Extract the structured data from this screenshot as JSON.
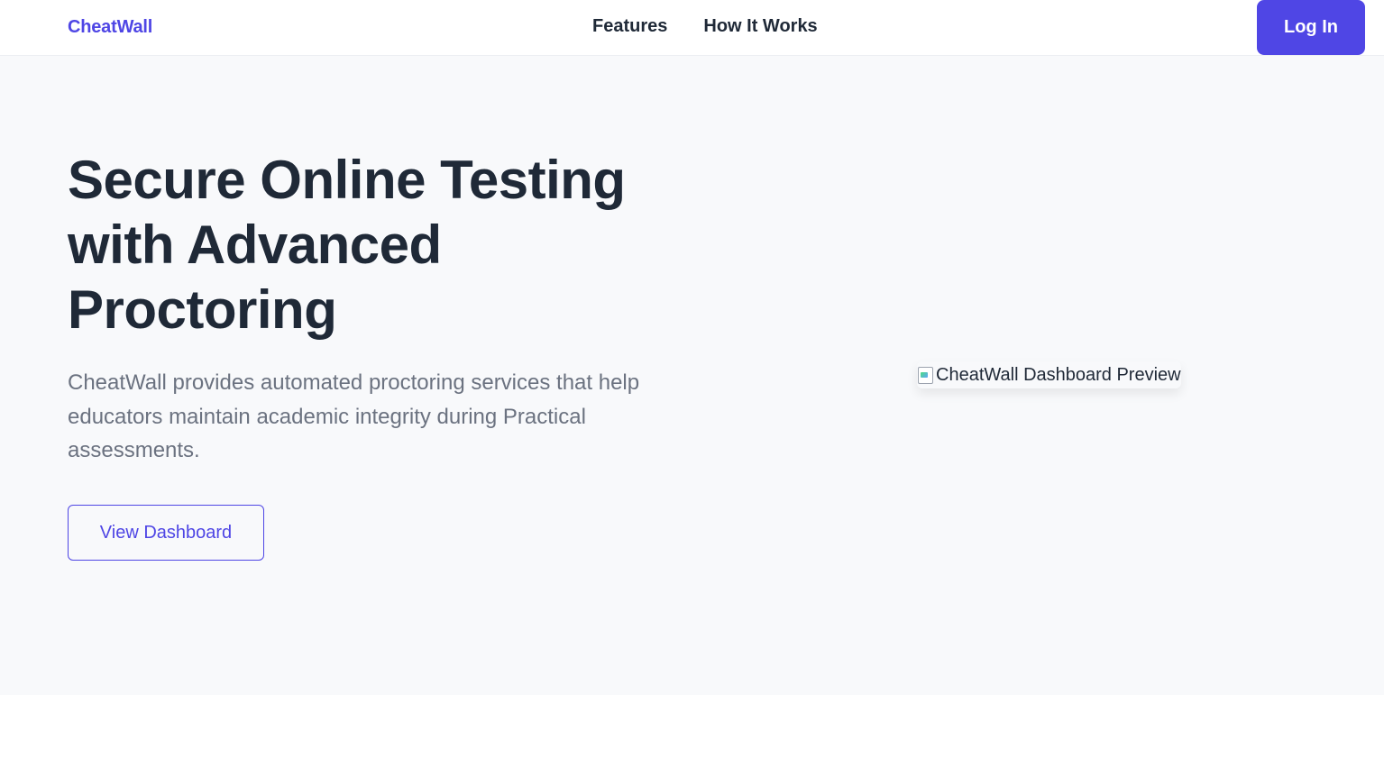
{
  "nav": {
    "logo": "CheatWall",
    "links": [
      "Features",
      "How It Works"
    ],
    "login_label": "Log In"
  },
  "hero": {
    "title": "Secure Online Testing with Advanced Proctoring",
    "description": "CheatWall provides automated proctoring services that help educators maintain academic integrity during Practical assessments.",
    "cta_label": "View Dashboard",
    "preview_alt": "CheatWall Dashboard Preview"
  },
  "colors": {
    "accent": "#4f46e5",
    "hero_bg": "#f8f9fb",
    "text_dark": "#1f2937",
    "text_muted": "#6b7280"
  },
  "icons": {
    "preview": "broken-image-icon"
  }
}
